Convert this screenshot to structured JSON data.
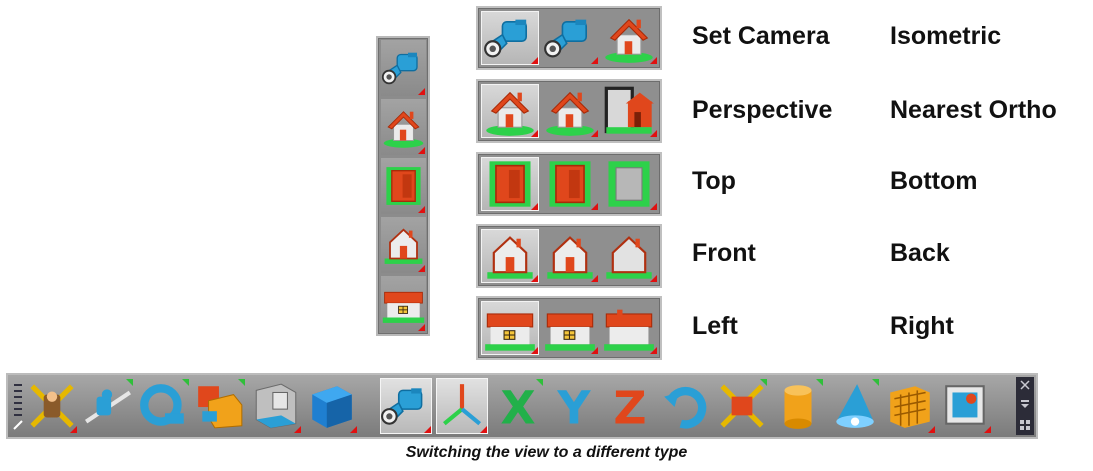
{
  "labels": {
    "set_camera": "Set Camera",
    "isometric": "Isometric",
    "perspective": "Perspective",
    "nearest_ortho": "Nearest Ortho",
    "top": "Top",
    "bottom": "Bottom",
    "front": "Front",
    "back": "Back",
    "left": "Left",
    "right": "Right"
  },
  "caption": "Switching the view to a different type",
  "vertical_strip": {
    "items": [
      "set-camera",
      "perspective",
      "top",
      "front",
      "left"
    ]
  },
  "flyouts": [
    {
      "row": "camera",
      "icons": [
        "set-camera-icon",
        "camera-icon",
        "isometric-house-icon"
      ],
      "selected": 0
    },
    {
      "row": "perspective",
      "icons": [
        "perspective-house-icon",
        "perspective-house-alt-icon",
        "nearest-ortho-icon"
      ],
      "selected": 0
    },
    {
      "row": "top-bottom",
      "icons": [
        "top-view-icon",
        "top-view-alt-icon",
        "bottom-view-icon"
      ],
      "selected": 0
    },
    {
      "row": "front-back",
      "icons": [
        "front-view-icon",
        "front-view-alt-icon",
        "back-view-icon"
      ],
      "selected": 0
    },
    {
      "row": "left-right",
      "icons": [
        "left-view-icon",
        "left-view-alt-icon",
        "right-view-icon"
      ],
      "selected": 0
    }
  ],
  "toolbar": {
    "buttons": [
      "move-tool-icon",
      "rotate-tool-icon",
      "orbit-icon",
      "box-object-icon",
      "room-icon",
      "cube-icon",
      "camera-icon",
      "axes-icon",
      "x-axis-icon",
      "y-axis-icon",
      "z-axis-icon",
      "undo-rotate-icon",
      "scale-tool-icon",
      "cylinder-icon",
      "spotlight-icon",
      "grid-cube-icon",
      "render-icon"
    ],
    "selected": [
      "camera-icon",
      "axes-icon"
    ]
  },
  "colors": {
    "accent_red": "#e01010",
    "accent_green": "#2fbf3a",
    "toolbar_gray": "#8f8f8f"
  }
}
